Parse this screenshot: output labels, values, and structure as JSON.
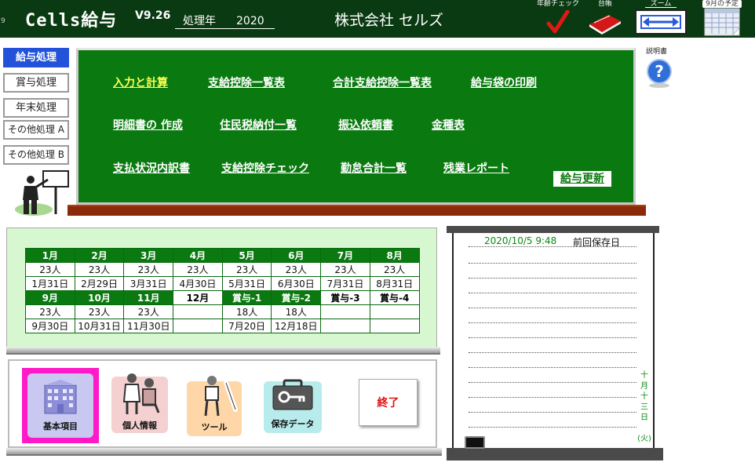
{
  "header": {
    "corner_num": "9",
    "app_title": "Cells給与",
    "version": "V9.26",
    "year_label": "処理年",
    "year_value": "2020",
    "company": "株式会社 セルズ",
    "tools": [
      {
        "label": "年齢チェック",
        "icon": "check-icon"
      },
      {
        "label": "台帳",
        "icon": "ledger-book-icon"
      },
      {
        "label": "ズーム",
        "icon": "zoom-arrows-icon"
      },
      {
        "label": "9月の予定",
        "icon": "calendar-icon"
      }
    ]
  },
  "sidebar": {
    "items": [
      {
        "label": "給与処理",
        "active": true
      },
      {
        "label": "賞与処理",
        "active": false
      },
      {
        "label": "年末処理",
        "active": false
      },
      {
        "label": "その他処理 A",
        "active": false
      },
      {
        "label": "その他処理 B",
        "active": false
      }
    ]
  },
  "board": {
    "menu": [
      {
        "label": "入力と計算",
        "active": true
      },
      {
        "label": "支給控除一覧表"
      },
      {
        "label": "合計支給控除一覧表"
      },
      {
        "label": "給与袋の印刷"
      },
      {
        "label": "明細書の 作成"
      },
      {
        "label": "住民税納付一覧"
      },
      {
        "label": "振込依頼書"
      },
      {
        "label": "金種表"
      },
      {
        "label": "支払状況内訳書"
      },
      {
        "label": "支給控除チェック"
      },
      {
        "label": "勤怠合計一覧"
      },
      {
        "label": "残業レポート"
      }
    ],
    "update_button": "給与更新",
    "bg_color": "#0a7a10"
  },
  "help": {
    "label": "説明書",
    "icon": "help-question-icon"
  },
  "calendar": {
    "row1_months": [
      "1月",
      "2月",
      "3月",
      "4月",
      "5月",
      "6月",
      "7月",
      "8月"
    ],
    "row1_counts": [
      "23人",
      "23人",
      "23人",
      "23人",
      "23人",
      "23人",
      "23人",
      "23人"
    ],
    "row1_dates": [
      "1月31日",
      "2月29日",
      "3月31日",
      "4月30日",
      "5月31日",
      "6月30日",
      "7月31日",
      "8月31日"
    ],
    "row2_months": [
      "9月",
      "10月",
      "11月",
      "12月",
      "賞与-1",
      "賞与-2",
      "賞与-3",
      "賞与-4"
    ],
    "row2_counts": [
      "23人",
      "23人",
      "23人",
      "",
      "18人",
      "18人",
      "",
      ""
    ],
    "row2_dates": [
      "9月30日",
      "10月31日",
      "11月30日",
      "",
      "7月20日",
      "12月18日",
      "",
      ""
    ]
  },
  "bottom_icons": [
    {
      "label": "基本項目",
      "icon": "building-icon",
      "selected": true
    },
    {
      "label": "個人情報",
      "icon": "people-icon"
    },
    {
      "label": "ツール",
      "icon": "tools-icon"
    },
    {
      "label": "保存データ",
      "icon": "toolbox-key-icon"
    }
  ],
  "exit_button": "終了",
  "memo": {
    "date": "2020/10/5 9:48",
    "saved_label": "前回保存日",
    "vertical_date": [
      "十",
      "月",
      "十",
      "三",
      "日",
      "",
      "(火)"
    ]
  }
}
